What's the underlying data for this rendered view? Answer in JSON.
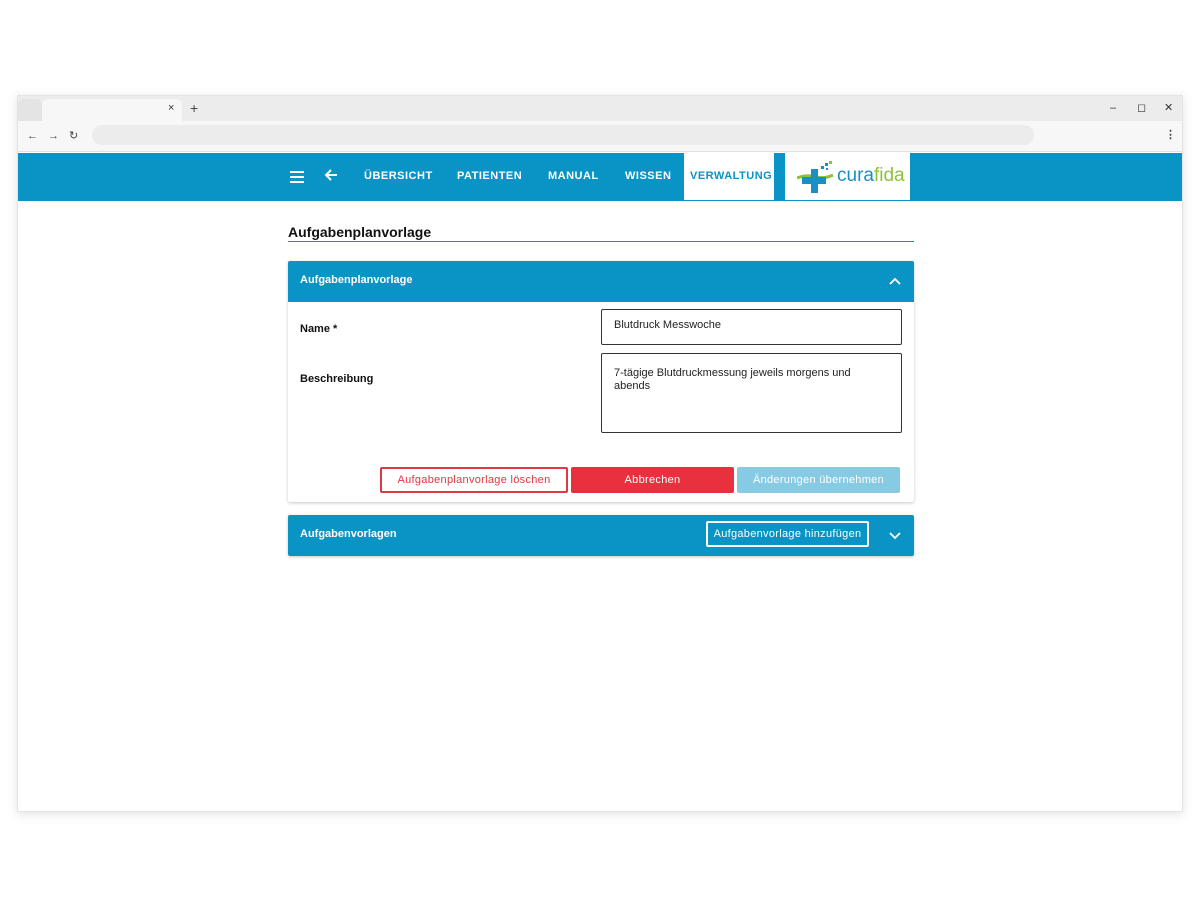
{
  "browser": {
    "tab_close": "×",
    "new_tab": "+",
    "window_controls": [
      "–",
      "◻",
      "✕"
    ],
    "nav": [
      "←",
      "→",
      "↻"
    ],
    "menu": "⋮"
  },
  "header": {
    "menu_icon": "hamburger-icon",
    "back_icon": "arrow-left-icon",
    "nav_items": [
      {
        "label": "ÜBERSICHT"
      },
      {
        "label": "PATIENTEN"
      },
      {
        "label": "MANUAL"
      },
      {
        "label": "WISSEN"
      },
      {
        "label": "VERWALTUNG",
        "active": true
      }
    ],
    "logo": {
      "part1": "cura",
      "part2": "fida"
    },
    "colors": {
      "primary": "#0a93c5",
      "logo_green": "#8bc23a"
    }
  },
  "page": {
    "title": "Aufgabenplanvorlage"
  },
  "template_panel": {
    "header": "Aufgabenplanvorlage",
    "expanded": true,
    "name_label": "Name *",
    "name_value": "Blutdruck Messwoche",
    "description_label": "Beschreibung",
    "description_value": "7-tägige Blutdruckmessung jeweils morgens und abends",
    "buttons": {
      "delete": "Aufgabenplanvorlage löschen",
      "cancel": "Abbrechen",
      "apply": "Änderungen übernehmen"
    },
    "colors": {
      "danger": "#e8303e",
      "apply_disabled": "#86cbe3"
    }
  },
  "tasks_panel": {
    "header": "Aufgabenvorlagen",
    "expanded": false,
    "add_button": "Aufgabenvorlage hinzufügen"
  }
}
